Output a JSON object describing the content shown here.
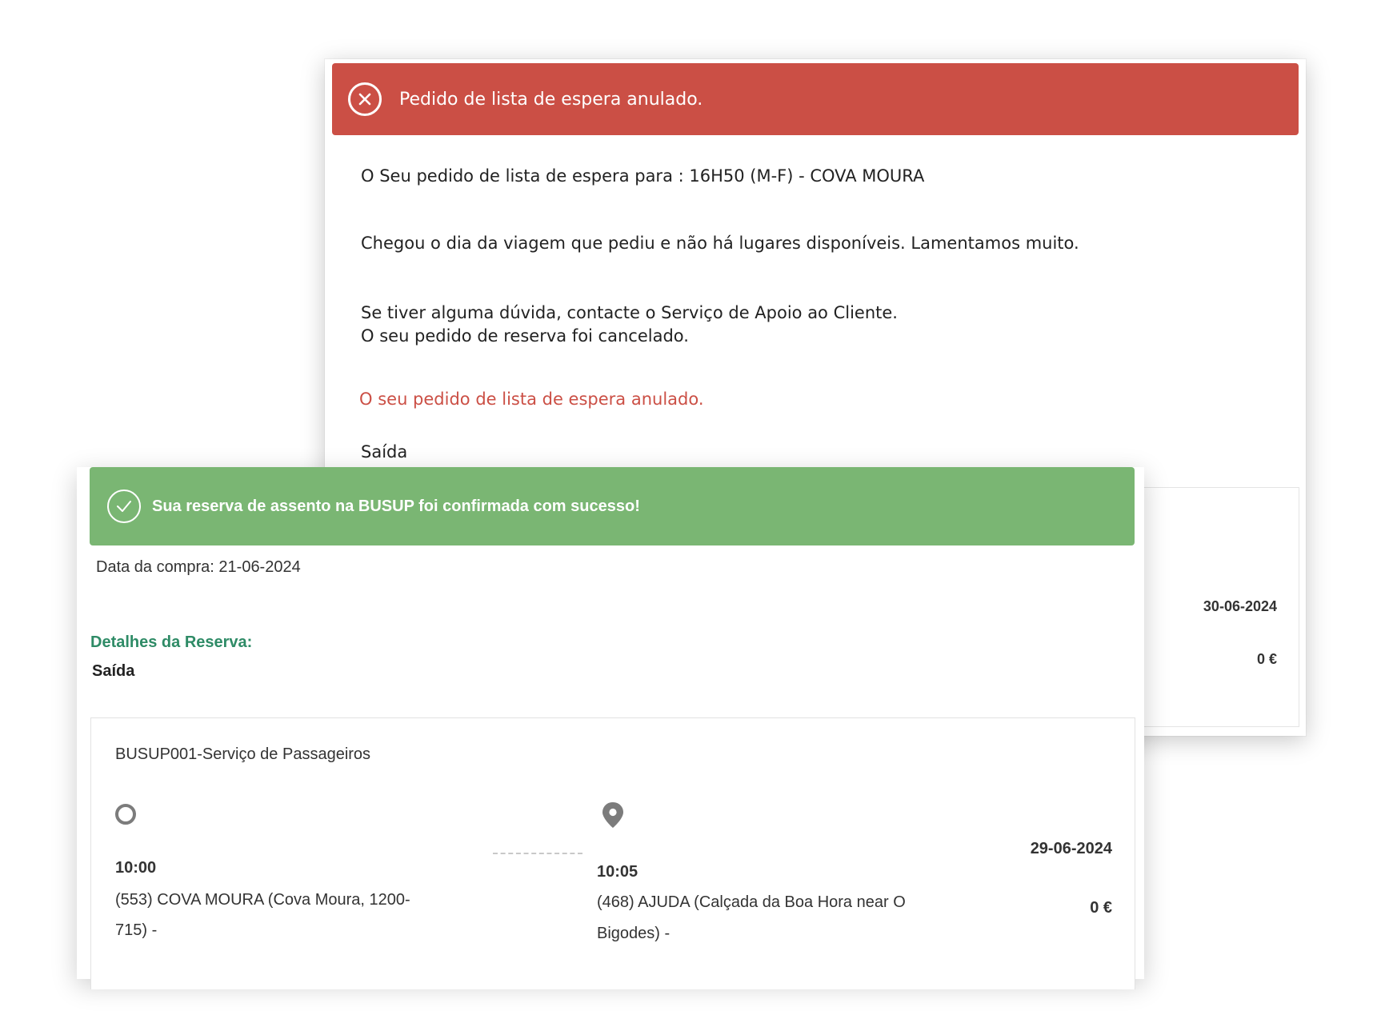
{
  "waitlist_notice": {
    "alert": {
      "icon": "close-circle-icon",
      "color": "#cb4f45",
      "message": "Pedido de lista de espera anulado."
    },
    "body": {
      "request_line": "O Seu pedido de lista de espera para : 16H50 (M-F) - COVA MOURA",
      "no_seats_line": "Chegou o dia da viagem que pediu e não há lugares disponíveis. Lamentamos muito.",
      "support_line": "Se tiver alguma dúvida, contacte o Serviço de Apoio ao Cliente.",
      "cancelled_line": "O seu pedido de reserva foi cancelado.",
      "status_line": "O seu pedido de lista de espera anulado.",
      "direction_label": "Saída"
    },
    "trip": {
      "date": "30-06-2024",
      "price": "0 €"
    }
  },
  "booking_confirmation": {
    "alert": {
      "icon": "check-circle-icon",
      "color": "#7ab673",
      "message": "Sua reserva de assento na BUSUP foi confirmada com sucesso!"
    },
    "purchase_date": "Data da compra: 21-06-2024",
    "section_title": "Detalhes da Reserva:",
    "direction_label": "Saída",
    "trip": {
      "service": "BUSUP001-Serviço de Passageiros",
      "origin": {
        "icon": "circle-outline-icon",
        "time": "10:00",
        "stop_line1": "(553) COVA MOURA (Cova Moura, 1200-",
        "stop_line2": "715) -"
      },
      "destination": {
        "icon": "map-pin-icon",
        "time": "10:05",
        "stop_line1": "(468) AJUDA (Calçada da Boa Hora near O",
        "stop_line2": "Bigodes) -"
      },
      "date": "29-06-2024",
      "price": "0 €"
    }
  }
}
